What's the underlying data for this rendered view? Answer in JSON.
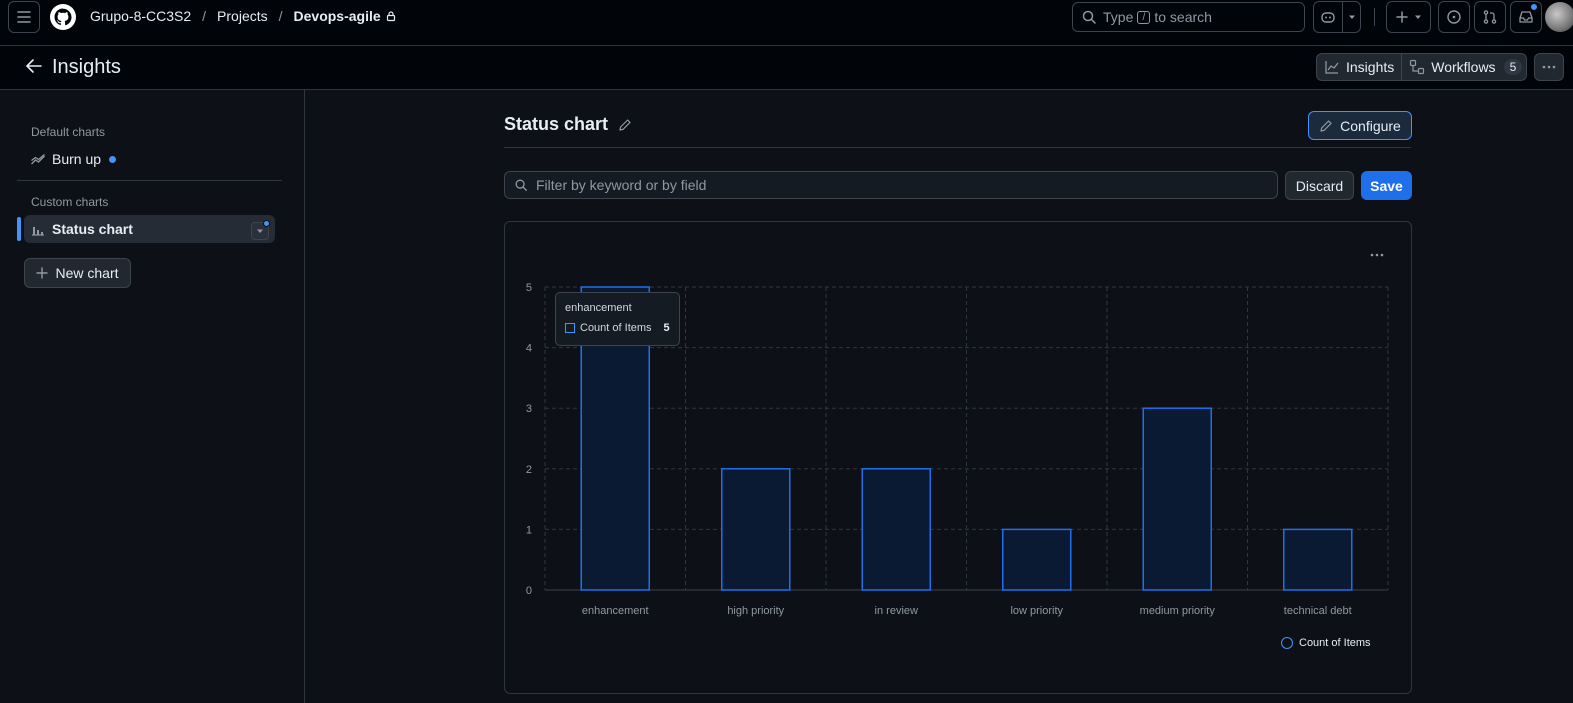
{
  "header": {
    "breadcrumb": [
      "Grupo-8-CC3S2",
      "Projects",
      "Devops-agile"
    ],
    "search_prefix": "Type",
    "search_key": "/",
    "search_suffix": "to search"
  },
  "subheader": {
    "title": "Insights",
    "tabs": [
      {
        "label": "Insights",
        "icon": "graph-icon"
      },
      {
        "label": "Workflows",
        "icon": "workflow-icon",
        "count": "5"
      }
    ]
  },
  "sidebar": {
    "default_heading": "Default charts",
    "default_items": [
      {
        "label": "Burn up",
        "icon": "burnup-icon"
      }
    ],
    "custom_heading": "Custom charts",
    "custom_items": [
      {
        "label": "Status chart",
        "icon": "bar-chart-icon"
      }
    ],
    "new_chart_label": "New chart"
  },
  "main": {
    "title": "Status chart",
    "configure_label": "Configure",
    "filter_placeholder": "Filter by keyword or by field",
    "discard_label": "Discard",
    "save_label": "Save"
  },
  "tooltip": {
    "category": "enhancement",
    "series": "Count of Items",
    "value": "5"
  },
  "colors": {
    "accent": "#4493f8",
    "bar_fill": "#0b1a33",
    "bar_stroke": "#1f6feb",
    "grid": "#30363d",
    "axis_text": "#9198a1"
  },
  "chart_data": {
    "type": "bar",
    "categories": [
      "enhancement",
      "high priority",
      "in review",
      "low priority",
      "medium priority",
      "technical debt"
    ],
    "series": [
      {
        "name": "Count of Items",
        "values": [
          5,
          2,
          2,
          1,
          3,
          1
        ]
      }
    ],
    "ylim": [
      0,
      5
    ],
    "yticks": [
      0,
      1,
      2,
      3,
      4,
      5
    ],
    "grid": true,
    "legend": "bottom-right"
  }
}
